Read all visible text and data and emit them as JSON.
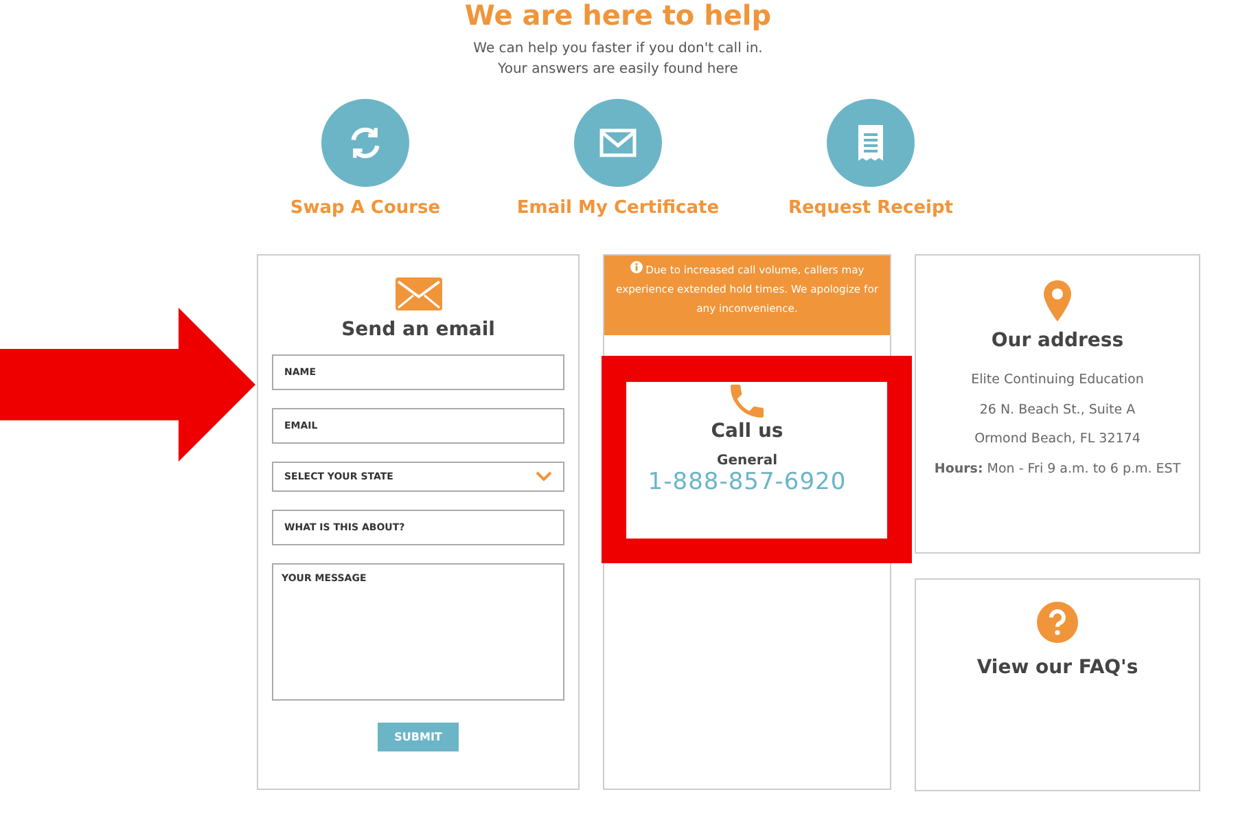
{
  "header": {
    "title": "We are here to help",
    "subtitle_lines": [
      "We can help you faster if you don't call in.",
      "Your answers are easily found here"
    ]
  },
  "quick_links": [
    {
      "kind": "swap",
      "label": "Swap A Course"
    },
    {
      "kind": "email",
      "label": "Email My Certificate"
    },
    {
      "kind": "receipt",
      "label": "Request Receipt"
    }
  ],
  "email_card": {
    "title": "Send an email",
    "fields": [
      {
        "kind": "input",
        "placeholder": "NAME"
      },
      {
        "kind": "input",
        "placeholder": "EMAIL"
      },
      {
        "kind": "select",
        "placeholder": "SELECT YOUR STATE"
      },
      {
        "kind": "input",
        "placeholder": "WHAT IS THIS ABOUT?"
      },
      {
        "kind": "textarea",
        "placeholder": "YOUR MESSAGE"
      }
    ],
    "submit": "SUBMIT"
  },
  "call_card": {
    "notice": "Due to increased call volume, callers may experience extended hold times. We apologize for any inconvenience.",
    "title": "Call us",
    "label": "General",
    "phone": "1-888-857-6920"
  },
  "address_card": {
    "title": "Our address",
    "lines": [
      "Elite Continuing Education",
      "26 N. Beach St., Suite A",
      "Ormond Beach, FL 32174",
      "**Hours:** Mon - Fri 9 a.m. to 6 p.m. EST"
    ]
  },
  "faq_card": {
    "title": "View our FAQ's"
  }
}
